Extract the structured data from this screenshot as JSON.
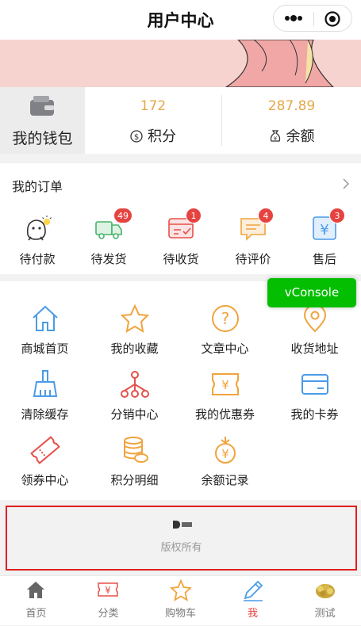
{
  "navbar": {
    "title": "用户中心"
  },
  "wallet": {
    "label": "我的钱包"
  },
  "stats": [
    {
      "value": "172",
      "label": "积分"
    },
    {
      "value": "287.89",
      "label": "余额"
    }
  ],
  "orders": {
    "title": "我的订单",
    "items": [
      {
        "label": "待付款",
        "badge": ""
      },
      {
        "label": "待发货",
        "badge": "49"
      },
      {
        "label": "待收货",
        "badge": "1"
      },
      {
        "label": "待评价",
        "badge": "4"
      },
      {
        "label": "售后",
        "badge": "3"
      }
    ]
  },
  "grid": {
    "items": [
      {
        "label": "商城首页"
      },
      {
        "label": "我的收藏"
      },
      {
        "label": "文章中心"
      },
      {
        "label": "收货地址"
      },
      {
        "label": "清除缓存"
      },
      {
        "label": "分销中心"
      },
      {
        "label": "我的优惠券"
      },
      {
        "label": "我的卡券"
      },
      {
        "label": "领券中心"
      },
      {
        "label": "积分明细"
      },
      {
        "label": "余额记录"
      }
    ]
  },
  "vconsole": {
    "label": "vConsole"
  },
  "footer": {
    "text": "版权所有"
  },
  "tabbar": {
    "items": [
      {
        "label": "首页"
      },
      {
        "label": "分类"
      },
      {
        "label": "购物车"
      },
      {
        "label": "我"
      },
      {
        "label": "测试"
      }
    ]
  },
  "colors": {
    "accent": "#e64340",
    "gold": "#e4a84a",
    "vconsole": "#04be02",
    "icon_blue": "#4a9be8",
    "icon_orange": "#f0a43c",
    "icon_red": "#e6504a"
  }
}
